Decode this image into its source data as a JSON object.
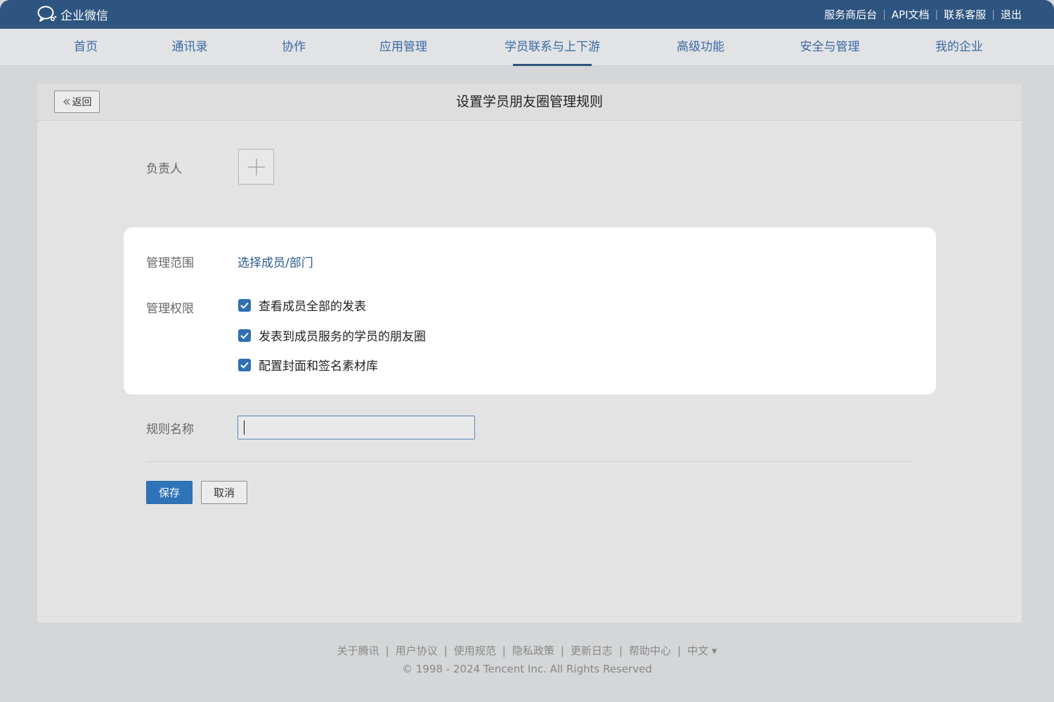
{
  "topbar": {
    "brand": "企业微信",
    "links": [
      "服务商后台",
      "API文档",
      "联系客服",
      "退出"
    ]
  },
  "nav": {
    "items": [
      "首页",
      "通讯录",
      "协作",
      "应用管理",
      "学员联系与上下游",
      "高级功能",
      "安全与管理",
      "我的企业"
    ],
    "active": "学员联系与上下游"
  },
  "panel": {
    "back_label": "返回",
    "title": "设置学员朋友圈管理规则"
  },
  "form": {
    "owner_label": "负责人",
    "scope_label": "管理范围",
    "scope_link": "选择成员/部门",
    "perm_label": "管理权限",
    "permissions": [
      {
        "label": "查看成员全部的发表",
        "checked": true
      },
      {
        "label": "发表到成员服务的学员的朋友圈",
        "checked": true
      },
      {
        "label": "配置封面和签名素材库",
        "checked": true
      }
    ],
    "rule_name_label": "规则名称",
    "rule_name_value": "",
    "save_label": "保存",
    "cancel_label": "取消"
  },
  "footer": {
    "links": [
      "关于腾讯",
      "用户协议",
      "使用规范",
      "隐私政策",
      "更新日志",
      "帮助中心",
      "中文 ▾"
    ],
    "copyright": "© 1998 - 2024 Tencent Inc. All Rights Reserved"
  },
  "colors": {
    "topbar": "#2e5480",
    "link": "#2c5a8c",
    "primary_button": "#2f74b8",
    "checkbox": "#2f6fb3"
  }
}
